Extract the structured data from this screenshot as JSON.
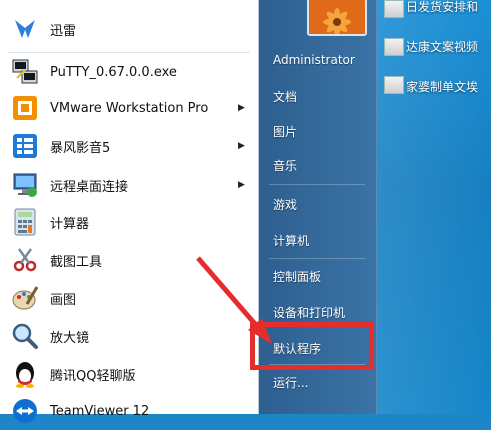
{
  "desktop": {
    "items": [
      {
        "label": "日发货安排和",
        "icon": "document-icon"
      },
      {
        "label": "达康文案视频",
        "icon": "document-icon"
      },
      {
        "label": "家婆制单文埃",
        "icon": "document-icon"
      }
    ]
  },
  "start_menu": {
    "programs": [
      {
        "label": "迅雷",
        "icon": "thunder-icon",
        "has_submenu": false
      },
      {
        "label": "PuTTY_0.67.0.0.exe",
        "icon": "putty-icon",
        "has_submenu": false
      },
      {
        "label": "VMware Workstation Pro",
        "icon": "vmware-icon",
        "has_submenu": true
      },
      {
        "label": "暴风影音5",
        "icon": "baofeng-icon",
        "has_submenu": true
      },
      {
        "label": "远程桌面连接",
        "icon": "remote-desktop-icon",
        "has_submenu": true
      },
      {
        "label": "计算器",
        "icon": "calculator-icon",
        "has_submenu": false
      },
      {
        "label": "截图工具",
        "icon": "snipping-tool-icon",
        "has_submenu": false
      },
      {
        "label": "画图",
        "icon": "paint-icon",
        "has_submenu": false
      },
      {
        "label": "放大镜",
        "icon": "magnifier-icon",
        "has_submenu": false
      },
      {
        "label": "腾讯QQ轻聊版",
        "icon": "qq-icon",
        "has_submenu": false
      },
      {
        "label": "TeamViewer 12",
        "icon": "teamviewer-icon",
        "has_submenu": false
      }
    ],
    "right": {
      "user": "Administrator",
      "items": [
        "文档",
        "图片",
        "音乐",
        "游戏",
        "计算机",
        "控制面板",
        "设备和打印机",
        "默认程序",
        "运行..."
      ]
    },
    "submenu_arrow": "▶"
  },
  "colors": {
    "highlight_box": "#e52d2d",
    "arrow": "#e52d2d"
  }
}
